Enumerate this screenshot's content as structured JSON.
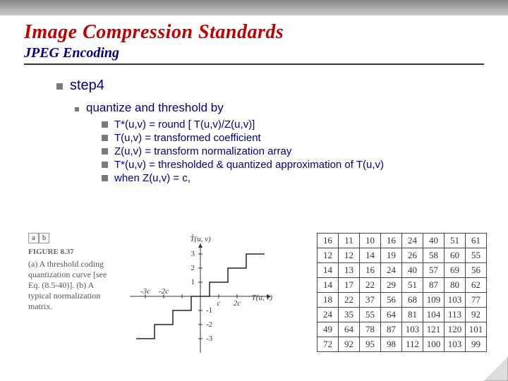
{
  "title": "Image Compression Standards",
  "subtitle": "JPEG Encoding",
  "step": {
    "label": "step4"
  },
  "sub1": {
    "label": "quantize and threshold by"
  },
  "bullets": [
    "T*(u,v) = round [ T(u,v)/Z(u,v)]",
    "T(u,v) = transformed coefficient",
    "Z(u,v) = transform normalization array",
    "T*(u,v) = thresholded & quantized approximation of T(u,v)",
    "when Z(u,v) = c,"
  ],
  "figure": {
    "label": "FIGURE 8.37",
    "ab": [
      "a",
      "b"
    ],
    "caption": "(a) A threshold coding quantization curve [see Eq. (8.5-40)]. (b) A typical normalization matrix.",
    "axis_y_label": "T̂(u, v)",
    "axis_x_label": "T(u, v)"
  },
  "chart_data": {
    "type": "line",
    "title": "Threshold coding quantization curve",
    "xlabel": "T(u,v)",
    "ylabel": "T*(u,v)",
    "x_ticks_neg": [
      "-3c",
      "-2c"
    ],
    "x_ticks_pos": [
      "c",
      "2c"
    ],
    "y_ticks_pos": [
      1,
      2,
      3
    ],
    "y_ticks_neg": [
      -1,
      -2,
      -3
    ],
    "xlim": [
      -3.5,
      3.5
    ],
    "ylim": [
      -3.5,
      3.5
    ],
    "step_breaks_x": [
      -3.5,
      -2.5,
      -1.5,
      -0.5,
      0.5,
      1.5,
      2.5,
      3.5
    ],
    "step_levels_y": [
      -3,
      -2,
      -1,
      0,
      1,
      2,
      3
    ]
  },
  "matrix": [
    [
      16,
      11,
      10,
      16,
      24,
      40,
      51,
      61
    ],
    [
      12,
      12,
      14,
      19,
      26,
      58,
      60,
      55
    ],
    [
      14,
      13,
      16,
      24,
      40,
      57,
      69,
      56
    ],
    [
      14,
      17,
      22,
      29,
      51,
      87,
      80,
      62
    ],
    [
      18,
      22,
      37,
      56,
      68,
      109,
      103,
      77
    ],
    [
      24,
      35,
      55,
      64,
      81,
      104,
      113,
      92
    ],
    [
      49,
      64,
      78,
      87,
      103,
      121,
      120,
      101
    ],
    [
      72,
      92,
      95,
      98,
      112,
      100,
      103,
      99
    ]
  ]
}
